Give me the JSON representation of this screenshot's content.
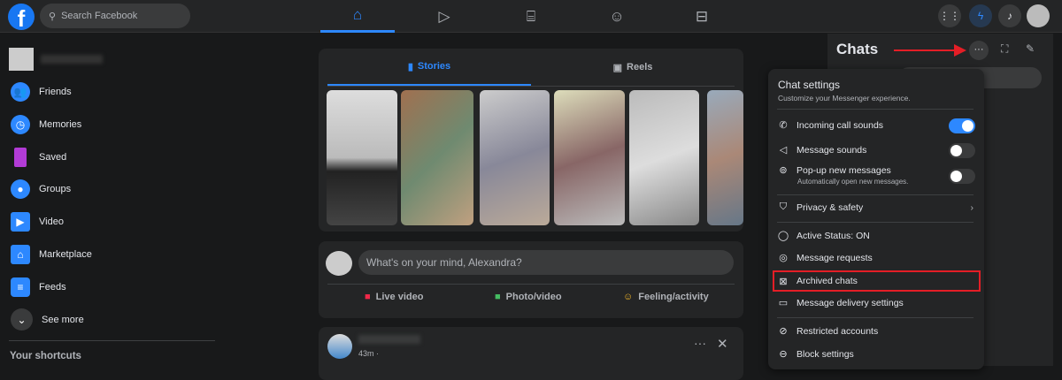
{
  "topbar": {
    "search_placeholder": "Search Facebook",
    "logo": "f",
    "nav": [
      "home-icon",
      "watch-icon",
      "marketplace-icon",
      "groups-icon",
      "gaming-icon"
    ]
  },
  "sidebar": {
    "items": [
      {
        "label": "Friends",
        "icon": "friends-icon",
        "color": "#2d88ff"
      },
      {
        "label": "Memories",
        "icon": "memories-icon",
        "color": "#2d88ff"
      },
      {
        "label": "Saved",
        "icon": "saved-icon",
        "color": "#b23bd6"
      },
      {
        "label": "Groups",
        "icon": "groups-icon",
        "color": "#2d88ff"
      },
      {
        "label": "Video",
        "icon": "video-icon",
        "color": "#2d88ff"
      },
      {
        "label": "Marketplace",
        "icon": "marketplace-icon",
        "color": "#2d88ff"
      },
      {
        "label": "Feeds",
        "icon": "feeds-icon",
        "color": "#2d88ff"
      }
    ],
    "see_more": "See more",
    "shortcuts": "Your shortcuts"
  },
  "stories": {
    "tabs": [
      "Stories",
      "Reels"
    ]
  },
  "composer": {
    "placeholder": "What's on your mind, Alexandra?",
    "actions": [
      {
        "label": "Live video",
        "color": "#f02849"
      },
      {
        "label": "Photo/video",
        "color": "#45bd62"
      },
      {
        "label": "Feeling/activity",
        "color": "#f7b928"
      }
    ]
  },
  "post": {
    "time": "43m ·"
  },
  "chats": {
    "title": "Chats"
  },
  "menu": {
    "title": "Chat settings",
    "subtitle": "Customize your Messenger experience.",
    "incoming": "Incoming call sounds",
    "message_sounds": "Message sounds",
    "popup": "Pop-up new messages",
    "popup_sub": "Automatically open new messages.",
    "privacy": "Privacy & safety",
    "active": "Active Status: ON",
    "requests": "Message requests",
    "archived": "Archived chats",
    "delivery": "Message delivery settings",
    "restricted": "Restricted accounts",
    "block": "Block settings",
    "toggles": {
      "incoming": true,
      "message_sounds": false,
      "popup": false
    }
  },
  "accent": "#2d88ff",
  "highlight": "#e41e26"
}
